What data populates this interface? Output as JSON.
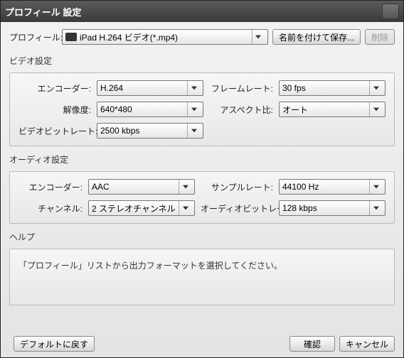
{
  "window": {
    "title": "プロフィール 設定"
  },
  "profile": {
    "label": "プロフィール:",
    "value": "iPad H.264 ビデオ(*.mp4)",
    "saveAs": "名前を付けて保存...",
    "delete": "削除"
  },
  "video": {
    "sectionLabel": "ビデオ設定",
    "encoderLabel": "エンコーダー:",
    "encoder": "H.264",
    "resolutionLabel": "解像度:",
    "resolution": "640*480",
    "frameRateLabel": "フレームレート:",
    "frameRate": "30 fps",
    "aspectLabel": "アスペクト比:",
    "aspect": "オート",
    "bitrateLabel": "ビデオビットレート:",
    "bitrate": "2500 kbps"
  },
  "audio": {
    "sectionLabel": "オーディオ設定",
    "encoderLabel": "エンコーダー:",
    "encoder": "AAC",
    "channelLabel": "チャンネル:",
    "channel": "2 ステレオチャンネル",
    "sampleRateLabel": "サンプルレート:",
    "sampleRate": "44100 Hz",
    "bitrateLabel": "オーディオビットレート:",
    "bitrate": "128 kbps"
  },
  "help": {
    "sectionLabel": "ヘルプ",
    "text": "「プロフィール」リストから出力フォーマットを選択してください。"
  },
  "footer": {
    "defaultReset": "デフォルトに戻す",
    "ok": "確認",
    "cancel": "キャンセル"
  }
}
